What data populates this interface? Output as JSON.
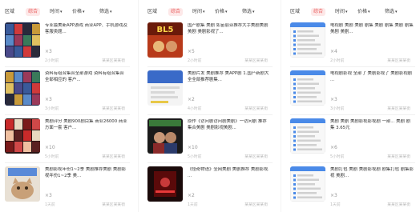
{
  "filters": [
    {
      "label": "区域",
      "active": false
    },
    {
      "label": "综合",
      "active": true
    },
    {
      "label": "时间",
      "active": false
    },
    {
      "label": "价格",
      "active": false
    },
    {
      "label": "筛选",
      "active": false
    }
  ],
  "colors": {
    "accent": "#e85a5a",
    "accent_bg": "#fde8e8",
    "meta": "#bbbbbb"
  },
  "panels": [
    {
      "cards": [
        {
          "title": "专业最美新APP游戏 商业APP、手机游戏及 客服类题...",
          "count": "×3",
          "meta_left": "2小时前",
          "meta_right": "某某区某某街",
          "thumb": "poster-grid"
        },
        {
          "title": "资料有组合集合全部游戏 资料有组合集合全部相应的 客户...",
          "count": "×3",
          "meta_left": "3小时前",
          "meta_right": "某某区某某街",
          "thumb": "poster-grid-2"
        },
        {
          "title": "美剧评分 美剧900剧目集 商业26000 商业方面一套 客户...",
          "count": "×10",
          "meta_left": "5小时前",
          "meta_right": "某某区某某街",
          "thumb": "poster-red"
        },
        {
          "title": "美剧影视年份1~2季 美剧推荐美剧 美剧影视年份1~2季 美...",
          "count": "×3",
          "meta_left": "1天前",
          "meta_right": "某某区某某街",
          "thumb": "cat"
        }
      ]
    },
    {
      "cards": [
        {
          "title": "国产剧集 美剧 如苗丽亚推荐大手美剧美剧美剧 美剧影视了...",
          "count": "×5",
          "meta_left": "2小时前",
          "meta_right": "某某区某某街",
          "thumb": "show-bl5"
        },
        {
          "title": "美剧片发 美剧推荐 美APP剧 1.国产新剧大全全部推荐剧集...",
          "count": "×2",
          "meta_left": "4小时前",
          "meta_right": "某某区某某街",
          "thumb": "screenshot"
        },
        {
          "title": "原作《访问剧访问剧美剧》一访问剧 推荐集合美剧 美剧影视美剧...",
          "count": "×10",
          "meta_left": "5小时前",
          "meta_right": "某某区某某街",
          "thumb": "poster-people"
        },
        {
          "title": "《怪奇物语》全网美剧 美剧推荐 美剧影视 ...",
          "count": "×2",
          "meta_left": "1天前",
          "meta_right": "某某区某某街",
          "thumb": "poster-dark"
        }
      ]
    },
    {
      "cards": [
        {
          "title": "电视剧 美剧 美剧 剧集 美剧 剧集 美剧 剧集 美剧 美剧...",
          "count": "×4",
          "meta_left": "2小时前",
          "meta_right": "某某区某某街",
          "thumb": "doc-list"
        },
        {
          "title": "电视剧影视 全部了 美剧影视了 美剧影视剧 ...",
          "count": "×3",
          "meta_left": "3小时前",
          "meta_right": "某某区某某街",
          "thumb": "doc-list-2"
        },
        {
          "title": "美剧 美剧 美剧影视影视剧 一部... 美剧 剧集 3.65元",
          "count": "×6",
          "meta_left": "5小时前",
          "meta_right": "某某区某某街",
          "thumb": "doc-list-3"
        },
        {
          "title": "美剧打包 美剧 美剧影视剧 剧集打包 剧集影视 美剧...",
          "count": "×3",
          "meta_left": "1天前",
          "meta_right": "某某区某某街",
          "thumb": "doc-list-4"
        }
      ]
    }
  ]
}
